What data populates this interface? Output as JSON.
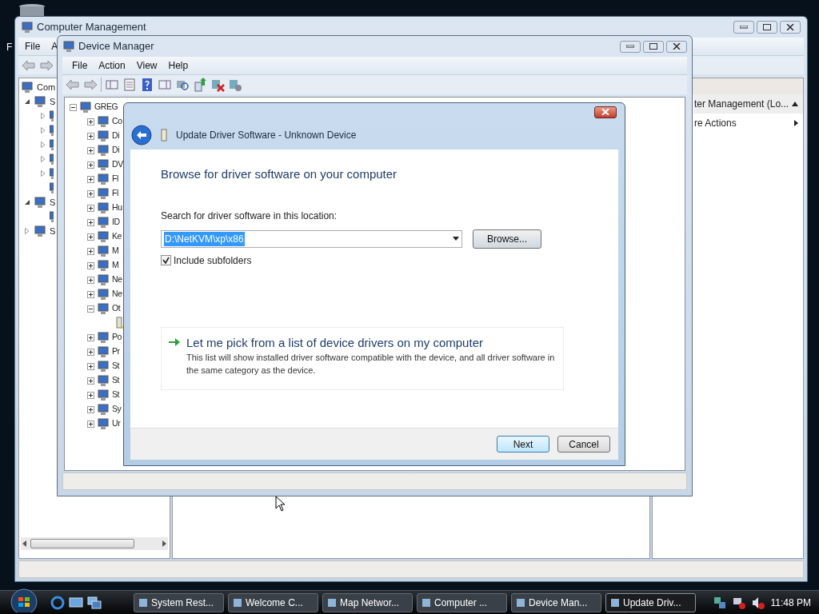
{
  "desktop": {
    "icon_label": "F"
  },
  "computer_management": {
    "title": "Computer Management",
    "menu": [
      "File",
      "A"
    ],
    "tree": [
      {
        "label": "Com",
        "kind": "root",
        "children": [
          {
            "label": "S",
            "expanded": true,
            "children": [
              {
                "expanded": false
              },
              {
                "expanded": false
              },
              {
                "expanded": false
              },
              {
                "expanded": false
              },
              {
                "expanded": false
              },
              {
                "kind": "leaf"
              }
            ]
          },
          {
            "label": "S",
            "expanded": true,
            "children": [
              {
                "kind": "leaf"
              }
            ]
          },
          {
            "label": "S",
            "expanded": false
          }
        ]
      }
    ],
    "actions": [
      {
        "label": "ter Management (Lo...",
        "kind": "header"
      },
      {
        "label": "re Actions",
        "kind": "submenu"
      }
    ]
  },
  "device_manager": {
    "title": "Device Manager",
    "menu": [
      "File",
      "Action",
      "View",
      "Help"
    ],
    "tree": [
      {
        "label": "GREG",
        "expanded": true,
        "children": [
          {
            "label": "Co",
            "expanded": false
          },
          {
            "label": "Di",
            "expanded": false
          },
          {
            "label": "Di",
            "expanded": false
          },
          {
            "label": "DV",
            "expanded": false
          },
          {
            "label": "Fl",
            "expanded": false
          },
          {
            "label": "Fl",
            "expanded": false
          },
          {
            "label": "Hu",
            "expanded": false
          },
          {
            "label": "ID",
            "expanded": false
          },
          {
            "label": "Ke",
            "expanded": false
          },
          {
            "label": "M",
            "expanded": false
          },
          {
            "label": "M",
            "expanded": false
          },
          {
            "label": "Ne",
            "expanded": false
          },
          {
            "label": "Ne",
            "expanded": false
          },
          {
            "label": "Ot",
            "expanded": true,
            "children": [
              {
                "kind": "leaf"
              }
            ]
          },
          {
            "label": "Po",
            "expanded": false
          },
          {
            "label": "Pr",
            "expanded": false
          },
          {
            "label": "St",
            "expanded": false
          },
          {
            "label": "St",
            "expanded": false
          },
          {
            "label": "St",
            "expanded": false
          },
          {
            "label": "Sy",
            "expanded": false
          },
          {
            "label": "Ur",
            "expanded": false
          }
        ]
      }
    ]
  },
  "dialog": {
    "title": "Update Driver Software - Unknown Device",
    "heading": "Browse for driver software on your computer",
    "location_label": "Search for driver software in this location:",
    "location": {
      "value": "D:\\NetKVM\\xp\\x86",
      "selected": true
    },
    "browse_button": "Browse...",
    "include_subfolders": {
      "label": "Include subfolders",
      "checked": true
    },
    "pick_option": {
      "title": "Let me pick from a list of device drivers on my computer",
      "description": "This list will show installed driver software compatible with the device, and all driver software in the same category as the device."
    },
    "buttons": [
      {
        "label": "Next",
        "kind": "default"
      },
      {
        "label": "Cancel",
        "kind": "normal"
      }
    ]
  },
  "taskbar": {
    "items": [
      {
        "label": "System Rest...",
        "selected": false
      },
      {
        "label": "Welcome C...",
        "selected": false
      },
      {
        "label": "Map Networ...",
        "selected": false
      },
      {
        "label": "Computer ...",
        "selected": false
      },
      {
        "label": "Device Man...",
        "selected": false
      },
      {
        "label": "Update Driv...",
        "selected": true
      }
    ],
    "clock": "11:48 PM"
  }
}
